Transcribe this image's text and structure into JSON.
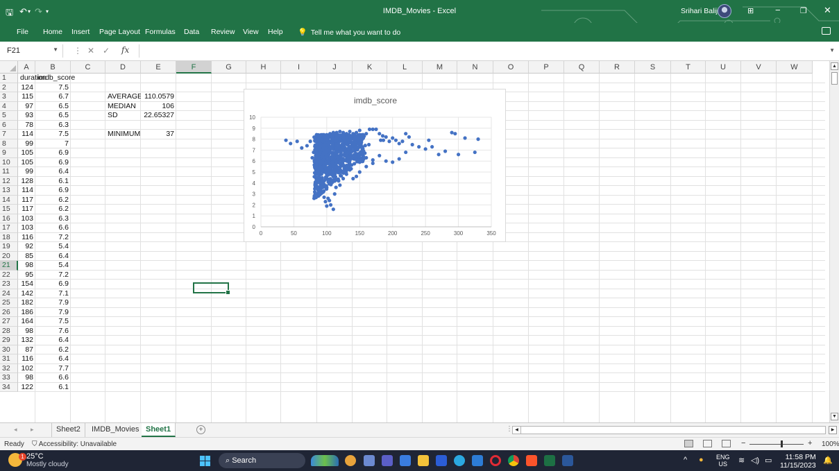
{
  "titlebar": {
    "title": "IMDB_Movies  -  Excel",
    "user": "Srihari Baliji"
  },
  "ribbon_tabs": [
    "File",
    "Home",
    "Insert",
    "Page Layout",
    "Formulas",
    "Data",
    "Review",
    "View",
    "Help"
  ],
  "tell_me": "Tell me what you want to do",
  "formula_bar": {
    "name_box": "F21",
    "fx": "fx",
    "formula": ""
  },
  "columns": [
    "A",
    "B",
    "C",
    "D",
    "E",
    "F",
    "G",
    "H",
    "I",
    "J",
    "K",
    "L",
    "M",
    "N",
    "O",
    "P",
    "Q",
    "R",
    "S",
    "T",
    "U",
    "V",
    "W"
  ],
  "selected_column": "F",
  "selected_row": 21,
  "rows": [
    {
      "n": "1",
      "a": "duration",
      "b": "imdb_score"
    },
    {
      "n": "2",
      "a": "124",
      "b": "7.5"
    },
    {
      "n": "3",
      "a": "115",
      "b": "6.7"
    },
    {
      "n": "4",
      "a": "97",
      "b": "6.5"
    },
    {
      "n": "5",
      "a": "93",
      "b": "6.5"
    },
    {
      "n": "6",
      "a": "78",
      "b": "6.3"
    },
    {
      "n": "7",
      "a": "114",
      "b": "7.5"
    },
    {
      "n": "8",
      "a": "99",
      "b": "7"
    },
    {
      "n": "9",
      "a": "105",
      "b": "6.9"
    },
    {
      "n": "10",
      "a": "105",
      "b": "6.9"
    },
    {
      "n": "11",
      "a": "99",
      "b": "6.4"
    },
    {
      "n": "12",
      "a": "128",
      "b": "6.1"
    },
    {
      "n": "13",
      "a": "114",
      "b": "6.9"
    },
    {
      "n": "14",
      "a": "117",
      "b": "6.2"
    },
    {
      "n": "15",
      "a": "117",
      "b": "6.2"
    },
    {
      "n": "16",
      "a": "103",
      "b": "6.3"
    },
    {
      "n": "17",
      "a": "103",
      "b": "6.6"
    },
    {
      "n": "18",
      "a": "116",
      "b": "7.2"
    },
    {
      "n": "19",
      "a": "92",
      "b": "5.4"
    },
    {
      "n": "20",
      "a": "85",
      "b": "6.4"
    },
    {
      "n": "21",
      "a": "98",
      "b": "5.4"
    },
    {
      "n": "22",
      "a": "95",
      "b": "7.2"
    },
    {
      "n": "23",
      "a": "154",
      "b": "6.9"
    },
    {
      "n": "24",
      "a": "142",
      "b": "7.1"
    },
    {
      "n": "25",
      "a": "182",
      "b": "7.9"
    },
    {
      "n": "26",
      "a": "186",
      "b": "7.9"
    },
    {
      "n": "27",
      "a": "164",
      "b": "7.5"
    },
    {
      "n": "28",
      "a": "98",
      "b": "7.6"
    },
    {
      "n": "29",
      "a": "132",
      "b": "6.4"
    },
    {
      "n": "30",
      "a": "87",
      "b": "6.2"
    },
    {
      "n": "31",
      "a": "116",
      "b": "6.4"
    },
    {
      "n": "32",
      "a": "102",
      "b": "7.7"
    },
    {
      "n": "33",
      "a": "98",
      "b": "6.6"
    },
    {
      "n": "34",
      "a": "122",
      "b": "6.1"
    }
  ],
  "stats": [
    {
      "label": "AVERAGE",
      "value": "110.0579"
    },
    {
      "label": "MEDIAN",
      "value": "106"
    },
    {
      "label": "SD",
      "value": "22.65327"
    },
    {
      "label": "MINIMUM",
      "value": "37"
    }
  ],
  "sheet_tabs": [
    "Sheet2",
    "IMDB_Movies",
    "Sheet1"
  ],
  "active_sheet": "Sheet1",
  "status": {
    "ready": "Ready",
    "accessibility": "Accessibility: Unavailable",
    "zoom": "100%"
  },
  "taskbar": {
    "temperature": "25°C",
    "weather": "Mostly cloudy",
    "search": "Search",
    "lang_top": "ENG",
    "lang_bottom": "US",
    "time": "11:58 PM",
    "date": "11/15/2023",
    "weather_badge": "1"
  },
  "colors": {
    "excel_green": "#217346",
    "series": "#4472c4",
    "taskbar": "#1f2535"
  },
  "chart_data": {
    "type": "scatter",
    "title": "imdb_score",
    "xlabel": "",
    "ylabel": "",
    "xlim": [
      0,
      350
    ],
    "ylim": [
      0,
      10
    ],
    "xticks": [
      0,
      50,
      100,
      150,
      200,
      250,
      300,
      350
    ],
    "yticks": [
      0,
      1,
      2,
      3,
      4,
      5,
      6,
      7,
      8,
      9,
      10
    ],
    "grid": true,
    "legend": "none",
    "series": [
      {
        "points": [
          [
            124,
            7.5
          ],
          [
            115,
            6.7
          ],
          [
            97,
            6.5
          ],
          [
            93,
            6.5
          ],
          [
            78,
            6.3
          ],
          [
            114,
            7.5
          ],
          [
            99,
            7
          ],
          [
            105,
            6.9
          ],
          [
            105,
            6.9
          ],
          [
            99,
            6.4
          ],
          [
            128,
            6.1
          ],
          [
            114,
            6.9
          ],
          [
            117,
            6.2
          ],
          [
            117,
            6.2
          ],
          [
            103,
            6.3
          ],
          [
            103,
            6.6
          ],
          [
            116,
            7.2
          ],
          [
            92,
            5.4
          ],
          [
            85,
            6.4
          ],
          [
            98,
            5.4
          ],
          [
            95,
            7.2
          ],
          [
            154,
            6.9
          ],
          [
            142,
            7.1
          ],
          [
            182,
            7.9
          ],
          [
            186,
            7.9
          ],
          [
            164,
            7.5
          ],
          [
            98,
            7.6
          ],
          [
            132,
            6.4
          ],
          [
            87,
            6.2
          ],
          [
            116,
            6.4
          ],
          [
            102,
            7.7
          ],
          [
            98,
            6.6
          ],
          [
            122,
            6.1
          ],
          [
            38,
            7.9
          ],
          [
            45,
            7.6
          ],
          [
            55,
            7.8
          ],
          [
            62,
            7.2
          ],
          [
            70,
            7.4
          ],
          [
            75,
            7.8
          ],
          [
            80,
            6.8
          ],
          [
            83,
            8.2
          ],
          [
            88,
            8.3
          ],
          [
            90,
            5.8
          ],
          [
            92,
            4.8
          ],
          [
            94,
            3.6
          ],
          [
            95,
            3.2
          ],
          [
            96,
            2.7
          ],
          [
            98,
            2.3
          ],
          [
            100,
            1.9
          ],
          [
            102,
            2.6
          ],
          [
            104,
            2.4
          ],
          [
            106,
            2.0
          ],
          [
            110,
            1.6
          ],
          [
            112,
            3.0
          ],
          [
            114,
            3.6
          ],
          [
            118,
            4.2
          ],
          [
            120,
            3.8
          ],
          [
            125,
            4.4
          ],
          [
            130,
            4.8
          ],
          [
            135,
            5.2
          ],
          [
            140,
            4.4
          ],
          [
            145,
            4.6
          ],
          [
            150,
            5.9
          ],
          [
            100,
            8.4
          ],
          [
            105,
            8.5
          ],
          [
            110,
            8.6
          ],
          [
            115,
            8.6
          ],
          [
            120,
            8.7
          ],
          [
            125,
            8.6
          ],
          [
            130,
            8.5
          ],
          [
            135,
            8.7
          ],
          [
            140,
            8.5
          ],
          [
            145,
            8.6
          ],
          [
            150,
            8.8
          ],
          [
            155,
            8.4
          ],
          [
            160,
            8.5
          ],
          [
            165,
            8.9
          ],
          [
            170,
            8.9
          ],
          [
            175,
            8.9
          ],
          [
            180,
            8.5
          ],
          [
            185,
            8.3
          ],
          [
            190,
            8.2
          ],
          [
            195,
            7.8
          ],
          [
            200,
            8.1
          ],
          [
            205,
            7.9
          ],
          [
            210,
            7.6
          ],
          [
            215,
            7.8
          ],
          [
            220,
            8.5
          ],
          [
            225,
            8.2
          ],
          [
            230,
            7.5
          ],
          [
            240,
            7.3
          ],
          [
            250,
            7.1
          ],
          [
            255,
            7.9
          ],
          [
            260,
            7.3
          ],
          [
            270,
            6.6
          ],
          [
            280,
            6.9
          ],
          [
            290,
            8.6
          ],
          [
            295,
            8.5
          ],
          [
            300,
            6.6
          ],
          [
            310,
            8.1
          ],
          [
            325,
            6.8
          ],
          [
            330,
            8.0
          ],
          [
            160,
            6.3
          ],
          [
            170,
            6.1
          ],
          [
            180,
            6.5
          ],
          [
            190,
            6.0
          ],
          [
            200,
            5.9
          ],
          [
            210,
            6.2
          ],
          [
            220,
            6.8
          ],
          [
            170,
            5.8
          ],
          [
            160,
            5.5
          ],
          [
            150,
            5.0
          ],
          [
            155,
            6.1
          ]
        ]
      }
    ]
  }
}
